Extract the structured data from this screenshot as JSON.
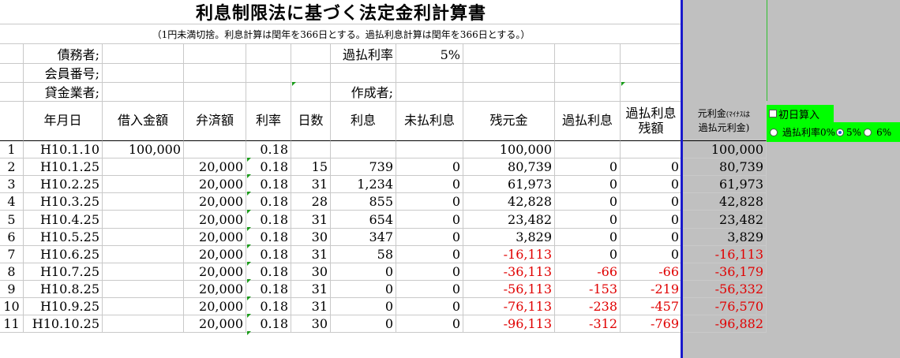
{
  "title": "利息制限法に基づく法定金利計算書",
  "note": "（1円未満切捨。利息計算は閏年を366日とする。過払利息計算は閏年を366日とする。）",
  "info": {
    "debtor_label": "債務者;",
    "member_label": "会員番号;",
    "lender_label": "貸金業者;",
    "overpay_rate_label": "過払利率",
    "overpay_rate_value": "5%",
    "creator_label": "作成者;"
  },
  "headers": {
    "date": "年月日",
    "loan": "借入金額",
    "repay": "弁済額",
    "rate": "利率",
    "days": "日数",
    "interest": "利息",
    "unpaid": "未払利息",
    "balance": "残元金",
    "overpay_interest": "過払利息",
    "overpay_balance_1": "過払利息",
    "overpay_balance_2": "残額",
    "principal_1": "元利金",
    "principal_small": "(ﾏｲﾅｽは",
    "principal_2": "過払元利金)"
  },
  "controls": {
    "first_day_label": "初日算入",
    "rate_opt_0": "過払利率0%",
    "rate_opt_5": "5%",
    "rate_opt_6": "6%"
  },
  "rows": [
    {
      "no": "1",
      "date": "H10.1.10",
      "loan": "100,000",
      "repay": "",
      "rate": "0.18",
      "days": "",
      "interest": "",
      "unpaid": "",
      "balance": "100,000",
      "ov_int": "",
      "ov_bal": "",
      "principal": "100,000"
    },
    {
      "no": "2",
      "date": "H10.1.25",
      "loan": "",
      "repay": "20,000",
      "rate": "0.18",
      "days": "15",
      "interest": "739",
      "unpaid": "0",
      "balance": "80,739",
      "ov_int": "0",
      "ov_bal": "0",
      "principal": "80,739"
    },
    {
      "no": "3",
      "date": "H10.2.25",
      "loan": "",
      "repay": "20,000",
      "rate": "0.18",
      "days": "31",
      "interest": "1,234",
      "unpaid": "0",
      "balance": "61,973",
      "ov_int": "0",
      "ov_bal": "0",
      "principal": "61,973"
    },
    {
      "no": "4",
      "date": "H10.3.25",
      "loan": "",
      "repay": "20,000",
      "rate": "0.18",
      "days": "28",
      "interest": "855",
      "unpaid": "0",
      "balance": "42,828",
      "ov_int": "0",
      "ov_bal": "0",
      "principal": "42,828"
    },
    {
      "no": "5",
      "date": "H10.4.25",
      "loan": "",
      "repay": "20,000",
      "rate": "0.18",
      "days": "31",
      "interest": "654",
      "unpaid": "0",
      "balance": "23,482",
      "ov_int": "0",
      "ov_bal": "0",
      "principal": "23,482"
    },
    {
      "no": "6",
      "date": "H10.5.25",
      "loan": "",
      "repay": "20,000",
      "rate": "0.18",
      "days": "30",
      "interest": "347",
      "unpaid": "0",
      "balance": "3,829",
      "ov_int": "0",
      "ov_bal": "0",
      "principal": "3,829"
    },
    {
      "no": "7",
      "date": "H10.6.25",
      "loan": "",
      "repay": "20,000",
      "rate": "0.18",
      "days": "31",
      "interest": "58",
      "unpaid": "0",
      "balance": "-16,113",
      "ov_int": "0",
      "ov_bal": "0",
      "principal": "-16,113"
    },
    {
      "no": "8",
      "date": "H10.7.25",
      "loan": "",
      "repay": "20,000",
      "rate": "0.18",
      "days": "30",
      "interest": "0",
      "unpaid": "0",
      "balance": "-36,113",
      "ov_int": "-66",
      "ov_bal": "-66",
      "principal": "-36,179"
    },
    {
      "no": "9",
      "date": "H10.8.25",
      "loan": "",
      "repay": "20,000",
      "rate": "0.18",
      "days": "31",
      "interest": "0",
      "unpaid": "0",
      "balance": "-56,113",
      "ov_int": "-153",
      "ov_bal": "-219",
      "principal": "-56,332"
    },
    {
      "no": "10",
      "date": "H10.9.25",
      "loan": "",
      "repay": "20,000",
      "rate": "0.18",
      "days": "31",
      "interest": "0",
      "unpaid": "0",
      "balance": "-76,113",
      "ov_int": "-238",
      "ov_bal": "-457",
      "principal": "-76,570"
    },
    {
      "no": "11",
      "date": "H10.10.25",
      "loan": "",
      "repay": "20,000",
      "rate": "0.18",
      "days": "30",
      "interest": "0",
      "unpaid": "0",
      "balance": "-96,113",
      "ov_int": "-312",
      "ov_bal": "-769",
      "principal": "-96,882"
    }
  ]
}
